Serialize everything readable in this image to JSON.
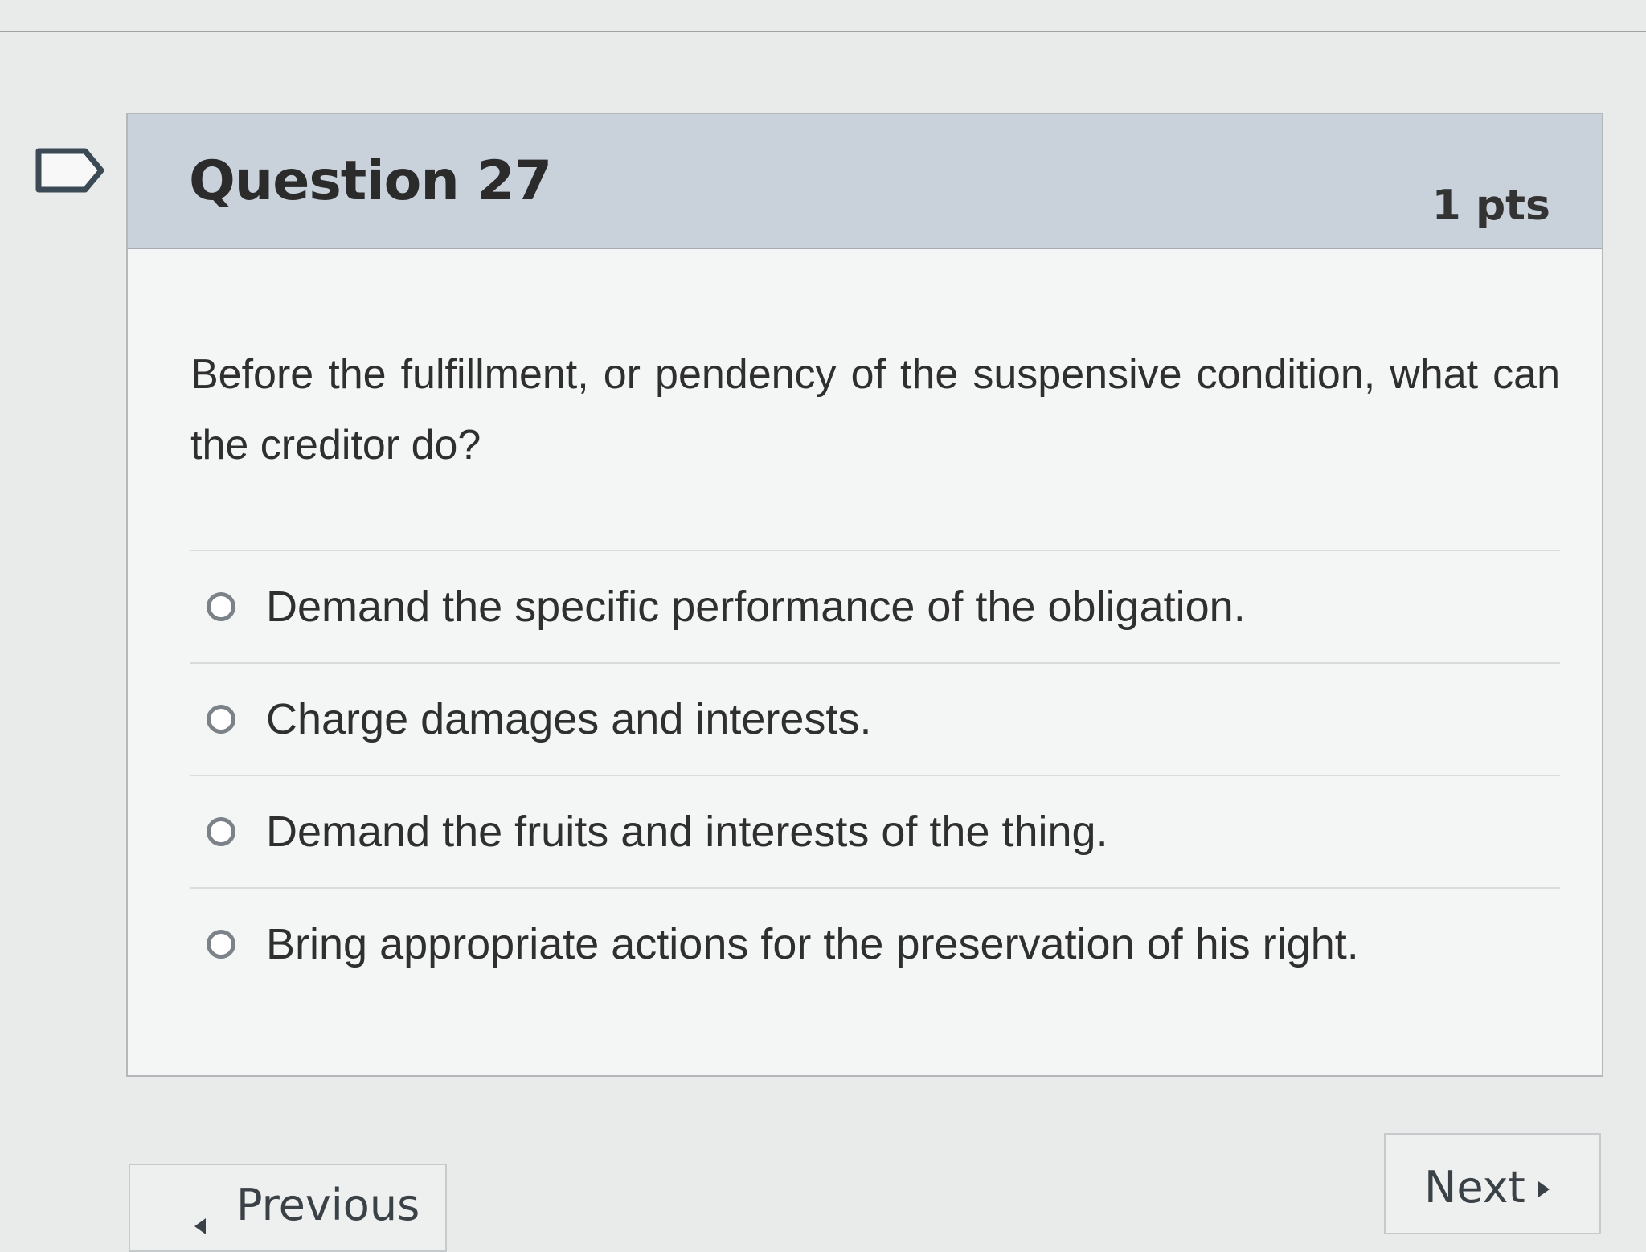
{
  "question": {
    "title": "Question 27",
    "points": "1 pts",
    "text": "Before the fulfillment, or pendency of the suspensive condition, what can the creditor do?"
  },
  "answers": [
    {
      "label": "Demand the specific performance of the obligation."
    },
    {
      "label": "Charge damages and interests."
    },
    {
      "label": "Demand the fruits and interests of the thing."
    },
    {
      "label": "Bring appropriate actions for the preservation of his right."
    }
  ],
  "navigation": {
    "previous_label": "Previous",
    "next_label": "Next"
  },
  "icons": {
    "flag": "flag-icon",
    "previous": "chevron-left-icon",
    "next": "chevron-right-icon"
  }
}
